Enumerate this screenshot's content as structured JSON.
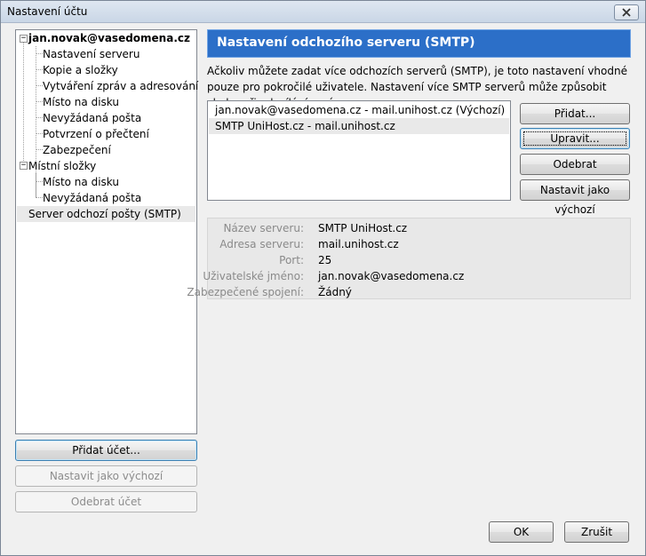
{
  "window": {
    "title": "Nastavení účtu"
  },
  "tree": {
    "account": "jan.novak@vasedomena.cz",
    "account_items": [
      "Nastavení serveru",
      "Kopie a složky",
      "Vytváření zpráv a adresování",
      "Místo na disku",
      "Nevyžádaná pošta",
      "Potvrzení o přečtení",
      "Zabezpečení"
    ],
    "local": "Místní složky",
    "local_items": [
      "Místo na disku",
      "Nevyžádaná pošta"
    ],
    "smtp": "Server odchozí pošty (SMTP)"
  },
  "left_buttons": {
    "add_account": "Přidat účet...",
    "set_default": "Nastavit jako výchozí",
    "remove_account": "Odebrat účet"
  },
  "panel": {
    "title": "Nastavení odchozího serveru (SMTP)",
    "description": "Ačkoliv můžete zadat více odchozích serverů (SMTP), je toto nastavení vhodné pouze pro pokročilé uživatele. Nastavení více SMTP serverů může způsobit chyby při odesílání zpráv."
  },
  "servers": [
    "jan.novak@vasedomena.cz - mail.unihost.cz (Výchozí)",
    "SMTP UniHost.cz - mail.unihost.cz"
  ],
  "server_buttons": {
    "add": "Přidat...",
    "edit": "Upravit...",
    "remove": "Odebrat",
    "set_default": "Nastavit jako výchozí"
  },
  "details": {
    "name_label": "Název serveru:",
    "name_value": "SMTP UniHost.cz",
    "address_label": "Adresa serveru:",
    "address_value": "mail.unihost.cz",
    "port_label": "Port:",
    "port_value": "25",
    "user_label": "Uživatelské jméno:",
    "user_value": "jan.novak@vasedomena.cz",
    "security_label": "Zabezpečené spojení:",
    "security_value": "Žádný"
  },
  "footer": {
    "ok": "OK",
    "cancel": "Zrušit"
  }
}
